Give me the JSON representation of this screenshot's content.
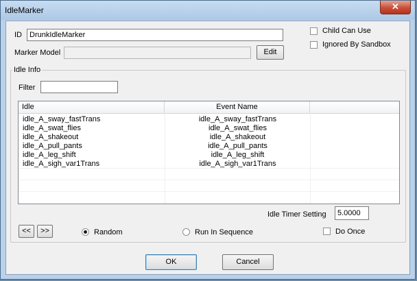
{
  "window": {
    "title": "IdleMarker",
    "close_glyph": "✕"
  },
  "fields": {
    "id_label": "ID",
    "id_value": "DrunkIdleMarker",
    "marker_model_label": "Marker Model",
    "marker_model_value": "",
    "edit_label": "Edit",
    "child_can_use_label": "Child Can Use",
    "ignored_by_sandbox_label": "Ignored By Sandbox"
  },
  "idle_info": {
    "group_title": "Idle Info",
    "filter_label": "Filter",
    "filter_value": "",
    "columns": [
      "Idle",
      "Event Name",
      ""
    ],
    "rows": [
      {
        "idle": "idle_A_sway_fastTrans",
        "event": "idle_A_sway_fastTrans"
      },
      {
        "idle": "idle_A_swat_flies",
        "event": "idle_A_swat_flies"
      },
      {
        "idle": "idle_A_shakeout",
        "event": "idle_A_shakeout"
      },
      {
        "idle": "idle_A_pull_pants",
        "event": "idle_A_pull_pants"
      },
      {
        "idle": "idle_A_leg_shift",
        "event": "idle_A_leg_shift"
      },
      {
        "idle": "idle_A_sigh_var1Trans",
        "event": "idle_A_sigh_var1Trans"
      }
    ],
    "timer_label": "Idle Timer Setting",
    "timer_value": "5.0000",
    "prev_label": "<<",
    "next_label": ">>",
    "random_label": "Random",
    "sequence_label": "Run In Sequence",
    "do_once_label": "Do Once",
    "random_checked": true
  },
  "buttons": {
    "ok_label": "OK",
    "cancel_label": "Cancel"
  }
}
